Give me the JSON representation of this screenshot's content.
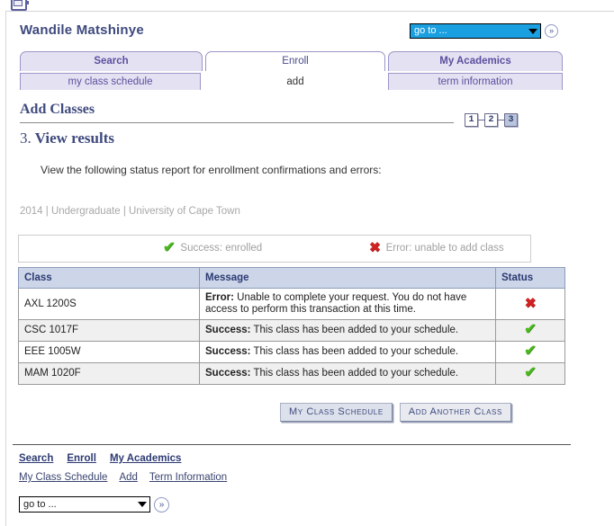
{
  "header": {
    "username": "Wandile Matshinye",
    "goto_value": "go to ...",
    "goto_button_icon": "»"
  },
  "tabs": [
    {
      "label": "Search",
      "active": false
    },
    {
      "label": "Enroll",
      "active": true
    },
    {
      "label": "My Academics",
      "active": false
    }
  ],
  "subtabs": [
    {
      "label": "my class schedule",
      "active": false
    },
    {
      "label": "add",
      "active": true
    },
    {
      "label": "term information",
      "active": false
    }
  ],
  "page": {
    "title": "Add Classes",
    "step_number": "3.",
    "step_title": "View results",
    "instructions": "View the following status report for enrollment confirmations and errors:",
    "term_line": "2014 | Undergraduate | University of Cape Town"
  },
  "steps": [
    {
      "label": "1",
      "current": false
    },
    {
      "label": "2",
      "current": false
    },
    {
      "label": "3",
      "current": true
    }
  ],
  "legend": {
    "success_label": "Success: enrolled",
    "error_label": "Error: unable to add class",
    "success_icon": "✔",
    "error_icon": "✖"
  },
  "results_table": {
    "columns": [
      "Class",
      "Message",
      "Status"
    ],
    "rows": [
      {
        "class": "AXL 1200S",
        "message_label": "Error:",
        "message_text": " Unable to complete your request. You do not have access to perform this transaction at this time.",
        "status": "error"
      },
      {
        "class": "CSC 1017F",
        "message_label": "Success:",
        "message_text": " This class has been added to your schedule.",
        "status": "success"
      },
      {
        "class": "EEE 1005W",
        "message_label": "Success:",
        "message_text": " This class has been added to your schedule.",
        "status": "success"
      },
      {
        "class": "MAM 1020F",
        "message_label": "Success:",
        "message_text": " This class has been added to your schedule.",
        "status": "success"
      }
    ]
  },
  "actions": {
    "my_class_schedule": "My Class Schedule",
    "add_another_class": "Add Another Class"
  },
  "footer": {
    "primary_links": [
      "Search",
      "Enroll",
      "My Academics"
    ],
    "secondary_links": [
      "My Class Schedule",
      "Add",
      "Term Information"
    ],
    "goto_value": "go to ...",
    "goto_button_icon": "»"
  },
  "colors": {
    "accent_navy": "#3f4a7e",
    "tab_lavender": "#e4e2f2",
    "table_header": "#ccd6e8",
    "success_green": "#4bb820",
    "error_red": "#cf2222",
    "select_highlight": "#1a9fe0"
  }
}
